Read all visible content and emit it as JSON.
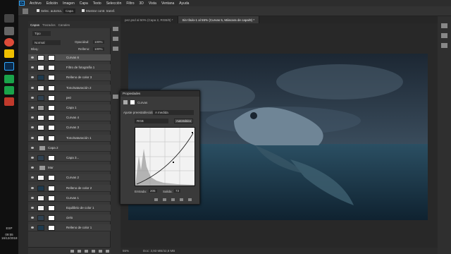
{
  "menu": [
    "Archivo",
    "Edición",
    "Imagen",
    "Capa",
    "Texto",
    "Selección",
    "Filtro",
    "3D",
    "Vista",
    "Ventana",
    "Ayuda"
  ],
  "options": {
    "auto_select": "Selec. automa.",
    "auto_value": "Capa",
    "transform": "Mostrar contr. transf."
  },
  "panel_tabs": [
    "Capas",
    "Trazados",
    "Canales"
  ],
  "layer_filter": "Tipo",
  "blend_mode": "Normal",
  "opacity_label": "Opacidad:",
  "opacity_value": "100%",
  "fill_label": "Relleno:",
  "fill_value": "100%",
  "lock_label": "Bloq.:",
  "layers": [
    {
      "name": "Curvas 6",
      "kind": "adjust"
    },
    {
      "name": "Filtro de fotografía 1",
      "kind": "adjust"
    },
    {
      "name": "Relleno de color 3",
      "kind": "fill"
    },
    {
      "name": "Tono/saturación 2",
      "kind": "adjust"
    },
    {
      "name": "pez",
      "kind": "image"
    },
    {
      "name": "Capa 1",
      "kind": "pattern"
    },
    {
      "name": "Curvas 4",
      "kind": "adjust"
    },
    {
      "name": "Curvas 3",
      "kind": "adjust"
    },
    {
      "name": "Tono/saturación 1",
      "kind": "adjust"
    },
    {
      "name": "Capa 2",
      "kind": "group"
    },
    {
      "name": "Capa 3...",
      "kind": "image"
    },
    {
      "name": "Mar",
      "kind": "group"
    },
    {
      "name": "Curvas 2",
      "kind": "adjust"
    },
    {
      "name": "Relleno de color 2",
      "kind": "fill"
    },
    {
      "name": "Curvas 1",
      "kind": "adjust"
    },
    {
      "name": "Equilibrio de color 1",
      "kind": "adjust"
    },
    {
      "name": "cielo",
      "kind": "image"
    },
    {
      "name": "Relleno de color 1",
      "kind": "fill"
    }
  ],
  "doc_tabs": [
    "pez.psd al 50% (Capa 2, RGB/8) *",
    "Sin título-1 al 55% (Curvas 5, Máscara de capa/8) *"
  ],
  "properties": {
    "title": "Propiedades",
    "panel_type": "Curvas",
    "preset_label": "Ajuste preestablecido:",
    "preset_value": "A medida",
    "channel": "RGB",
    "auto": "Automático",
    "input_label": "Entrada:",
    "input_value": "205",
    "output_label": "Salida:",
    "output_value": "73"
  },
  "status": {
    "zoom": "55%",
    "doc": "Doc: 3,93 MB/42,8 MB"
  },
  "taskbar": {
    "lang": "ESP",
    "time": "09:55",
    "date": "16/12/2018"
  },
  "colors": {
    "accent": "#2d6cb0",
    "water": "#1d3a4e",
    "sky": "#2f4150"
  }
}
